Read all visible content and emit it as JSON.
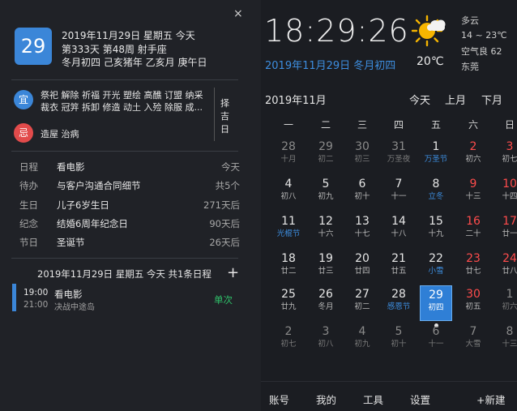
{
  "left": {
    "close_glyph": "×",
    "day_number": "29",
    "header_line1": "2019年11月29日 星期五 今天",
    "header_line2": "第333天 第48周 射手座",
    "header_line3": "冬月初四 己亥猪年 乙亥月 庚午日",
    "yi_label": "宜",
    "yi_line1": "祭祀 解除 祈福 开光 塑绘 高醮 订盟 纳采",
    "yi_line2": "裁衣 冠笄 拆卸 修造 动土 入殓 除服 成...",
    "ji_label": "忌",
    "ji_text": "造屋 治病",
    "zeji": "择吉日",
    "events": [
      {
        "type": "日程",
        "title": "看电影",
        "when": "今天"
      },
      {
        "type": "待办",
        "title": "与客户沟通合同细节",
        "when": "共5个"
      },
      {
        "type": "生日",
        "title": "儿子6岁生日",
        "when": "271天后"
      },
      {
        "type": "纪念",
        "title": "结婚6周年纪念日",
        "when": "90天后"
      },
      {
        "type": "节日",
        "title": "圣诞节",
        "when": "26天后"
      }
    ],
    "schedule_title": "2019年11月29日 星期五 今天 共1条日程",
    "add_glyph": "+",
    "schedule": {
      "start": "19:00",
      "end": "21:00",
      "name": "看电影",
      "location": "决战中途岛",
      "repeat": "单次"
    }
  },
  "right": {
    "time": "18:29:26",
    "date_line": "2019年11月29日 冬月初四",
    "temperature": "20℃",
    "weather_icon": "partly-cloudy-sun-icon",
    "weather_desc": "多云",
    "temp_range": "14 ~ 23℃",
    "air_quality": "空气良 62",
    "city": "东莞",
    "month_label": "2019年11月",
    "nav": {
      "today": "今天",
      "prev": "上月",
      "next": "下月"
    },
    "weekdays": [
      "一",
      "二",
      "三",
      "四",
      "五",
      "六",
      "日"
    ],
    "days": [
      [
        {
          "n": "28",
          "s": "十月",
          "dim": true
        },
        {
          "n": "29",
          "s": "初二",
          "dim": true
        },
        {
          "n": "30",
          "s": "初三",
          "dim": true
        },
        {
          "n": "31",
          "s": "万圣夜",
          "dim": true
        },
        {
          "n": "1",
          "s": "万圣节",
          "sblue": true
        },
        {
          "n": "2",
          "s": "初六",
          "red": true
        },
        {
          "n": "3",
          "s": "初七",
          "red": true
        }
      ],
      [
        {
          "n": "4",
          "s": "初八"
        },
        {
          "n": "5",
          "s": "初九"
        },
        {
          "n": "6",
          "s": "初十"
        },
        {
          "n": "7",
          "s": "十一"
        },
        {
          "n": "8",
          "s": "立冬",
          "sblue": true
        },
        {
          "n": "9",
          "s": "十三",
          "red": true
        },
        {
          "n": "10",
          "s": "十四",
          "red": true
        }
      ],
      [
        {
          "n": "11",
          "s": "光棍节",
          "sblue": true
        },
        {
          "n": "12",
          "s": "十六"
        },
        {
          "n": "13",
          "s": "十七"
        },
        {
          "n": "14",
          "s": "十八"
        },
        {
          "n": "15",
          "s": "十九"
        },
        {
          "n": "16",
          "s": "二十",
          "red": true
        },
        {
          "n": "17",
          "s": "廿一",
          "red": true
        }
      ],
      [
        {
          "n": "18",
          "s": "廿二"
        },
        {
          "n": "19",
          "s": "廿三"
        },
        {
          "n": "20",
          "s": "廿四"
        },
        {
          "n": "21",
          "s": "廿五"
        },
        {
          "n": "22",
          "s": "小雪",
          "sblue": true
        },
        {
          "n": "23",
          "s": "廿七",
          "red": true
        },
        {
          "n": "24",
          "s": "廿八",
          "red": true
        }
      ],
      [
        {
          "n": "25",
          "s": "廿九"
        },
        {
          "n": "26",
          "s": "冬月"
        },
        {
          "n": "27",
          "s": "初二"
        },
        {
          "n": "28",
          "s": "感恩节",
          "sblue": true
        },
        {
          "n": "29",
          "s": "初四",
          "today": true
        },
        {
          "n": "30",
          "s": "初五",
          "red": true
        },
        {
          "n": "1",
          "s": "初六",
          "dim": true
        }
      ],
      [
        {
          "n": "2",
          "s": "初七",
          "dim": true
        },
        {
          "n": "3",
          "s": "初八",
          "dim": true
        },
        {
          "n": "4",
          "s": "初九",
          "dim": true
        },
        {
          "n": "5",
          "s": "初十",
          "dim": true
        },
        {
          "n": "6",
          "s": "十一",
          "dim": true
        },
        {
          "n": "7",
          "s": "大雪",
          "dim": true
        },
        {
          "n": "8",
          "s": "十三",
          "dim": true
        }
      ]
    ],
    "bottom": [
      "账号",
      "我的",
      "工具",
      "设置",
      "+新建"
    ],
    "colors": {
      "accent": "#3b86d8",
      "weekend_red": "#ff4c4c",
      "festival_blue": "#3d8ee0",
      "dim": "#8a8a8a",
      "repeat_green": "#2fc26a"
    }
  }
}
